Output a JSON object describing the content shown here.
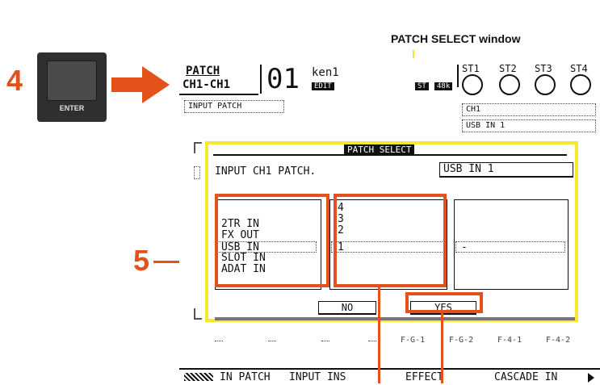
{
  "annotation": {
    "window_label": "PATCH SELECT window",
    "step4": "4",
    "step5": "5",
    "enter_key_label": "ENTER"
  },
  "header": {
    "patch": "PATCH",
    "ch_range": "CH1-CH1",
    "scene_number": "01",
    "scene_name": "ken1",
    "edit_badge": "EDIT",
    "st_badge": "ST",
    "rate_badge": "48k",
    "st_channels": [
      "ST1",
      "ST2",
      "ST3",
      "ST4"
    ],
    "input_patch_box": "INPUT PATCH",
    "ch_box": "CH1",
    "usb_box": "USB IN 1"
  },
  "dialog": {
    "title": "PATCH SELECT",
    "prompt": "INPUT CH1 PATCH.",
    "current_value": "USB IN 1",
    "sources": [
      "2TR IN",
      "FX OUT",
      "USB IN",
      "SLOT IN",
      "ADAT IN"
    ],
    "numbers": [
      "4",
      "3",
      "2",
      "1"
    ],
    "third_column_value": "-",
    "no_button": "NO",
    "yes_button": "YES"
  },
  "bottom_row": [
    "F-G-1",
    "F-G-2",
    "F-4-1",
    "F-4-2"
  ],
  "tabs": [
    "IN PATCH",
    "INPUT INS",
    "EFFECT",
    "CASCADE IN"
  ],
  "colors": {
    "accent": "#e4521b",
    "highlight": "#f5e92b",
    "lcd_bg": "#ffffff"
  }
}
